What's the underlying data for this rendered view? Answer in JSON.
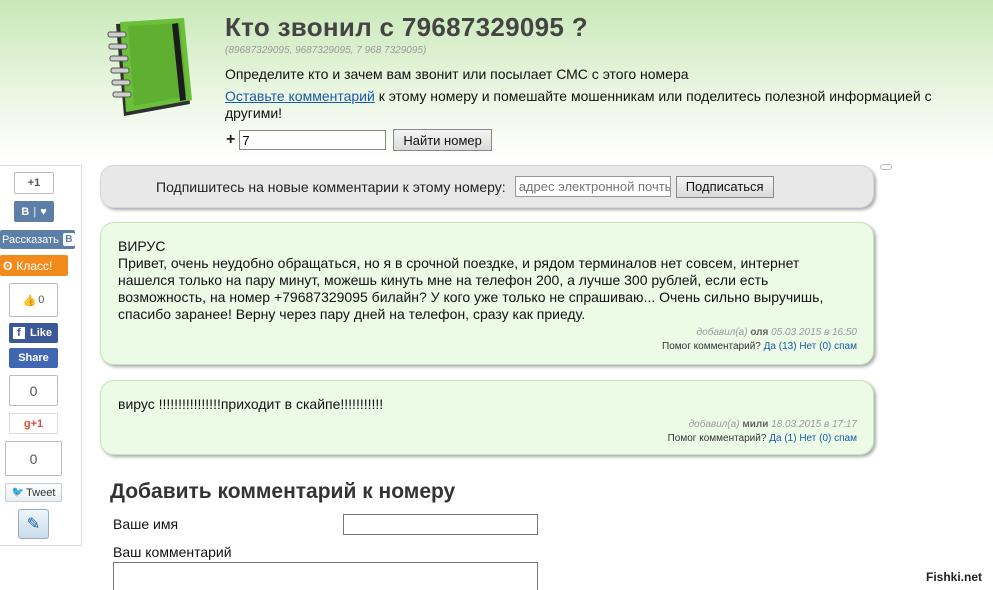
{
  "header": {
    "title": "Кто звонил с 79687329095 ?",
    "number_variants": "(89687329095, 9687329095, 7 968 7329095)",
    "intro": "Определите кто и зачем вам звонит или посылает СМС с этого номера",
    "cta_link": "Оставьте комментарий",
    "cta_rest": " к этому номеру и помешайте мошенникам или поделитесь полезной информацией с другими!"
  },
  "search": {
    "prefix": "+",
    "value": "7",
    "button_label": "Найти номер"
  },
  "subscribe": {
    "label": "Подпишитесь на новые комментарии к этому номеру:",
    "placeholder": "адрес электронной почты",
    "button_label": "Подписаться"
  },
  "share": {
    "gplus_count_top": "+1",
    "vk_label": "В",
    "vk_heart": "♥",
    "rasskazat_label": "Рассказать",
    "rasskazat_mark": "В",
    "ok_label": "Класс!",
    "like_count": "0",
    "fb_like_label": "Like",
    "fb_share_label": "Share",
    "counter_a": "0",
    "gplus_label": "g+1",
    "counter_b": "0",
    "tweet_label": "Tweet"
  },
  "comments": [
    {
      "text": "ВИРУС\nПривет, очень неудобно обращаться, но я в срочной поездке, и рядом терминалов нет совсем, интернет нашелся только на пару минут, можешь кинуть мне на телефон 200, а лучше 300 рублей, если есть возможность, на номер +79687329095 билайн? У кого уже только не спрашиваю... Очень сильно выручишь, спасибо заранее! Верну через пару дней на телефон, сразу как приеду.",
      "added_by_label": "добавил(а)",
      "author": "оля",
      "date": "05.03.2015 в 16:50",
      "helped_label": "Помог комментарий?",
      "yes_label": "Да (13)",
      "no_label": "Нет (0)",
      "spam_label": "спам"
    },
    {
      "text": "вирус !!!!!!!!!!!!!!!!приходит в скайпе!!!!!!!!!!!",
      "added_by_label": "добавил(а)",
      "author": "мили",
      "date": "18.03.2015 в 17:17",
      "helped_label": "Помог комментарий?",
      "yes_label": "Да (1)",
      "no_label": "Нет (0)",
      "spam_label": "спам"
    }
  ],
  "add_form": {
    "title": "Добавить комментарий к номеру",
    "name_label": "Ваше имя",
    "comment_label": "Ваш комментарий"
  },
  "watermark": "Fishki.net"
}
